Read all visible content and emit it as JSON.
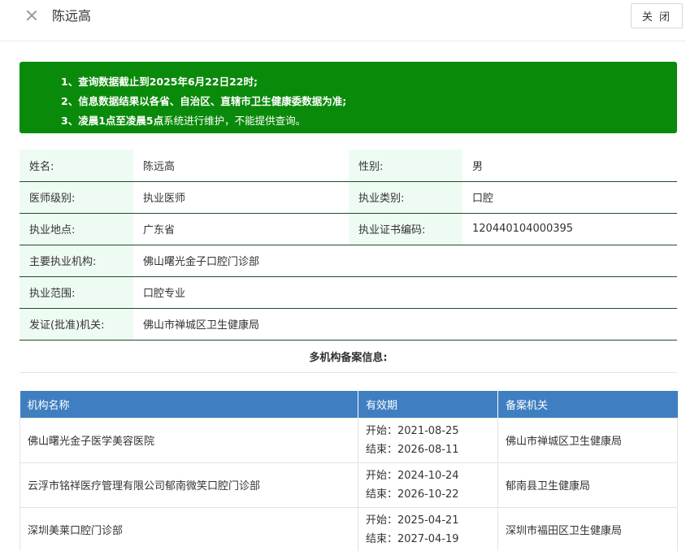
{
  "header": {
    "title": "陈远高",
    "close_button": "关 闭"
  },
  "notice": {
    "line1": "1、查询数据截止到2025年6月22日22时;",
    "line2": "2、信息数据结果以各省、自治区、直辖市卫生健康委数据为准;",
    "line3_bold": "3、凌晨1点至凌晨5点",
    "line3_rest": "系统进行维护，不能提供查询。"
  },
  "info": {
    "name_label": "姓名:",
    "name_value": "陈远高",
    "gender_label": "性别:",
    "gender_value": "男",
    "level_label": "医师级别:",
    "level_value": "执业医师",
    "category_label": "执业类别:",
    "category_value": "口腔",
    "location_label": "执业地点:",
    "location_value": "广东省",
    "cert_label": "执业证书编码:",
    "cert_value": "120440104000395",
    "org_label": "主要执业机构:",
    "org_value": "佛山曙光金子口腔门诊部",
    "scope_label": "执业范围:",
    "scope_value": "口腔专业",
    "issuer_label": "发证(批准)机关:",
    "issuer_value": "佛山市禅城区卫生健康局",
    "section_title": "多机构备案信息:"
  },
  "multi": {
    "columns": [
      "机构名称",
      "有效期",
      "备案机关"
    ],
    "rows": [
      {
        "org": "佛山曙光金子医学美容医院",
        "start": "开始：2021-08-25",
        "end": "结束：2026-08-11",
        "authority": "佛山市禅城区卫生健康局"
      },
      {
        "org": "云浮市铭祥医疗管理有限公司郁南微笑口腔门诊部",
        "start": "开始：2024-10-24",
        "end": "结束：2026-10-22",
        "authority": "郁南县卫生健康局"
      },
      {
        "org": "深圳美莱口腔门诊部",
        "start": "开始：2025-04-21",
        "end": "结束：2027-04-19",
        "authority": "深圳市福田区卫生健康局"
      }
    ]
  }
}
